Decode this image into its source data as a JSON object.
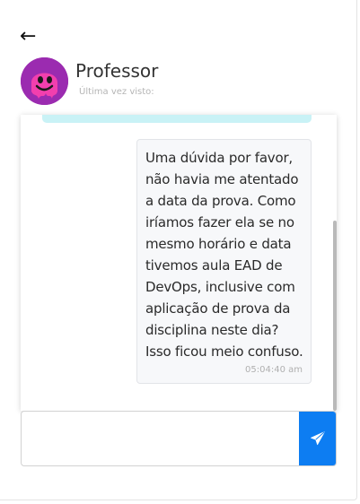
{
  "header": {
    "back_glyph": "←",
    "contact_name": "Professor",
    "last_seen": "Última vez visto:"
  },
  "avatar": {
    "icon": "smiley-face-icon",
    "background": "#9b2bb0",
    "face_color": "#f23fae"
  },
  "messages": [
    {
      "text": "Uma dúvida por favor, não havia me atentado a data da prova. Como iríamos fazer ela se no mesmo horário e data tivemos aula EAD de DevOps, inclusive com aplicação de prova da disciplina neste dia? Isso ficou meio confuso.",
      "time": "05:04:40 am"
    }
  ],
  "composer": {
    "value": "",
    "placeholder": "",
    "send_icon": "paper-plane-icon"
  },
  "colors": {
    "accent": "#0d7df2",
    "previous_bubble": "#c9f2f6",
    "bubble_bg": "#f7f8fa"
  }
}
